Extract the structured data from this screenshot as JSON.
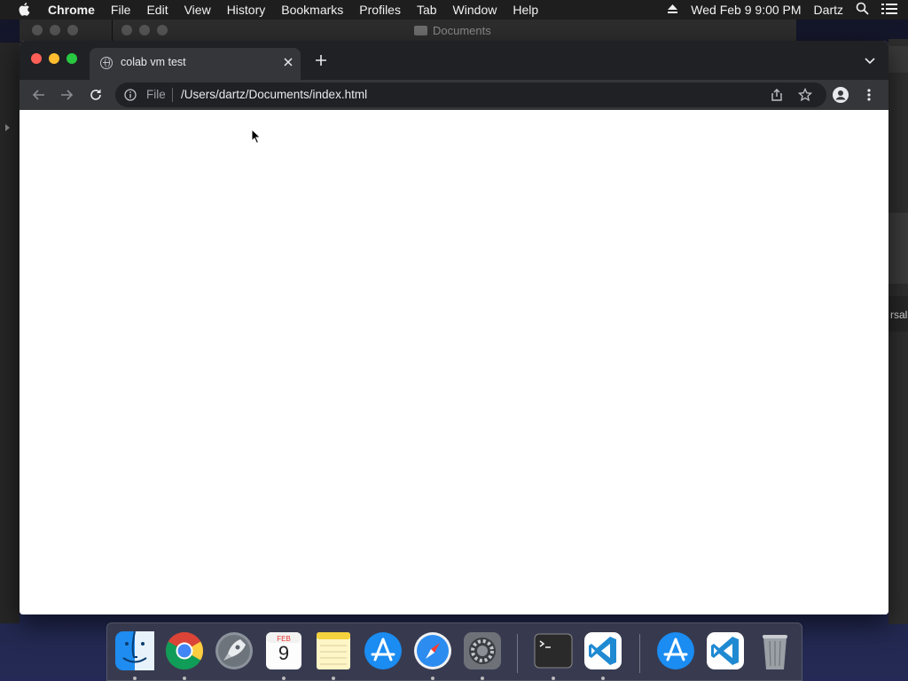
{
  "menubar": {
    "apple_icon": "apple-logo-icon",
    "app_name": "Chrome",
    "items": [
      "File",
      "Edit",
      "View",
      "History",
      "Bookmarks",
      "Profiles",
      "Tab",
      "Window",
      "Help"
    ],
    "datetime": "Wed Feb 9  9:00 PM",
    "user": "Dartz"
  },
  "background_window": {
    "title": "Documents",
    "fragment_text": "rsal"
  },
  "browser": {
    "tab": {
      "title": "colab vm test"
    },
    "omnibox": {
      "scheme": "File",
      "url": "/Users/dartz/Documents/index.html"
    }
  },
  "dock": {
    "apps": [
      "Finder",
      "Google Chrome",
      "Launchpad",
      "Calendar",
      "Notes",
      "App Store",
      "Safari",
      "System Preferences",
      "Terminal",
      "Visual Studio Code",
      "App Store Installer",
      "Visual Studio Code",
      "Trash"
    ],
    "calendar": {
      "month": "FEB",
      "day": "9"
    }
  },
  "colors": {
    "tabstrip": "#202124",
    "toolbar": "#35363a",
    "close": "#ff5f57",
    "minimize": "#febc2e",
    "maximize": "#28c840"
  }
}
